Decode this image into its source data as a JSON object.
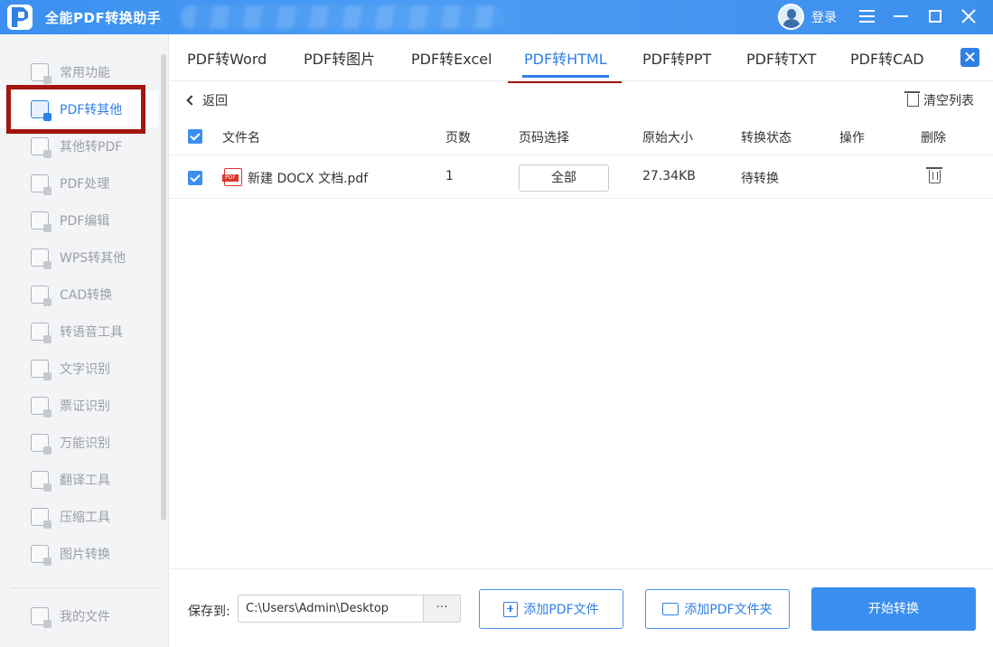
{
  "app": {
    "title": "全能PDF转换助手",
    "login_label": "登录"
  },
  "sidebar": {
    "items": [
      {
        "label": "常用功能",
        "icon": "star-grid-icon",
        "active": false
      },
      {
        "label": "PDF转其他",
        "icon": "pdf-convert-icon",
        "active": true
      },
      {
        "label": "其他转PDF",
        "icon": "to-pdf-icon",
        "active": false
      },
      {
        "label": "PDF处理",
        "icon": "pdf-process-icon",
        "active": false
      },
      {
        "label": "PDF编辑",
        "icon": "pdf-edit-icon",
        "active": false
      },
      {
        "label": "WPS转其他",
        "icon": "wps-icon",
        "active": false
      },
      {
        "label": "CAD转换",
        "icon": "cad-icon",
        "active": false
      },
      {
        "label": "转语音工具",
        "icon": "voice-icon",
        "active": false
      },
      {
        "label": "文字识别",
        "icon": "ocr-icon",
        "active": false
      },
      {
        "label": "票证识别",
        "icon": "ticket-icon",
        "active": false
      },
      {
        "label": "万能识别",
        "icon": "camera-icon",
        "active": false
      },
      {
        "label": "翻译工具",
        "icon": "translate-icon",
        "active": false
      },
      {
        "label": "压缩工具",
        "icon": "zip-icon",
        "active": false
      },
      {
        "label": "图片转换",
        "icon": "image-icon",
        "active": false
      }
    ],
    "my_files_label": "我的文件"
  },
  "tabs": [
    {
      "label": "PDF转Word",
      "active": false
    },
    {
      "label": "PDF转图片",
      "active": false
    },
    {
      "label": "PDF转Excel",
      "active": false
    },
    {
      "label": "PDF转HTML",
      "active": true
    },
    {
      "label": "PDF转PPT",
      "active": false
    },
    {
      "label": "PDF转TXT",
      "active": false
    },
    {
      "label": "PDF转CAD",
      "active": false
    }
  ],
  "toolbar": {
    "back_label": "返回",
    "clear_label": "清空列表"
  },
  "table": {
    "headers": [
      "文件名",
      "页数",
      "页码选择",
      "原始大小",
      "转换状态",
      "操作",
      "删除"
    ],
    "rows": [
      {
        "name": "新建 DOCX 文档.pdf",
        "pages": "1",
        "page_select": "全部",
        "size": "27.34KB",
        "status": "待转换",
        "checked": true
      }
    ]
  },
  "bottom": {
    "save_label": "保存到:",
    "save_path": "C:\\Users\\Admin\\Desktop",
    "browse_label": "···",
    "add_file_label": "添加PDF文件",
    "add_folder_label": "添加PDF文件夹",
    "start_label": "开始转换"
  },
  "colors": {
    "accent": "#3a8ff0",
    "highlight_box": "#a3150f",
    "sidebar_bg": "#f3f4f6"
  }
}
